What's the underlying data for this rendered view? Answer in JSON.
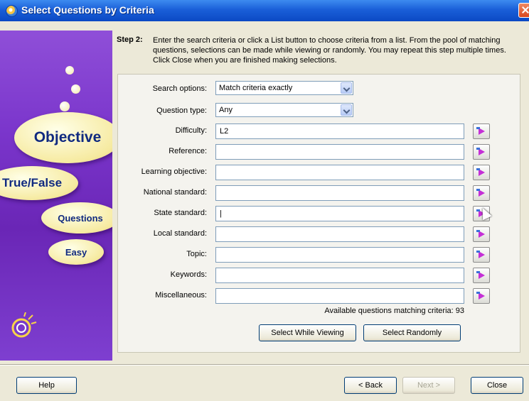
{
  "window": {
    "title": "Select Questions by Criteria"
  },
  "sidebar": {
    "ovals": [
      "Objective",
      "True/False",
      "Questions",
      "Easy"
    ]
  },
  "instructions": {
    "step_label": "Step 2:",
    "text": "Enter the search criteria or click a List button to choose criteria from a list. From the pool of matching questions, selections can be made while viewing or randomly. You may repeat this step multiple times. Click Close when you are finished making selections."
  },
  "form": {
    "search_options": {
      "label": "Search options:",
      "value": "Match criteria exactly"
    },
    "question_type": {
      "label": "Question type:",
      "value": "Any"
    },
    "fields": [
      {
        "label": "Difficulty:",
        "value": "L2"
      },
      {
        "label": "Reference:",
        "value": ""
      },
      {
        "label": "Learning objective:",
        "value": ""
      },
      {
        "label": "National standard:",
        "value": ""
      },
      {
        "label": "State standard:",
        "value": "|"
      },
      {
        "label": "Local standard:",
        "value": ""
      },
      {
        "label": "Topic:",
        "value": ""
      },
      {
        "label": "Keywords:",
        "value": ""
      },
      {
        "label": "Miscellaneous:",
        "value": ""
      }
    ],
    "available_text": "Available questions matching criteria: 93",
    "select_while_viewing": "Select While Viewing",
    "select_randomly": "Select Randomly"
  },
  "footer": {
    "help": "Help",
    "back": "< Back",
    "next": "Next >",
    "close": "Close"
  }
}
